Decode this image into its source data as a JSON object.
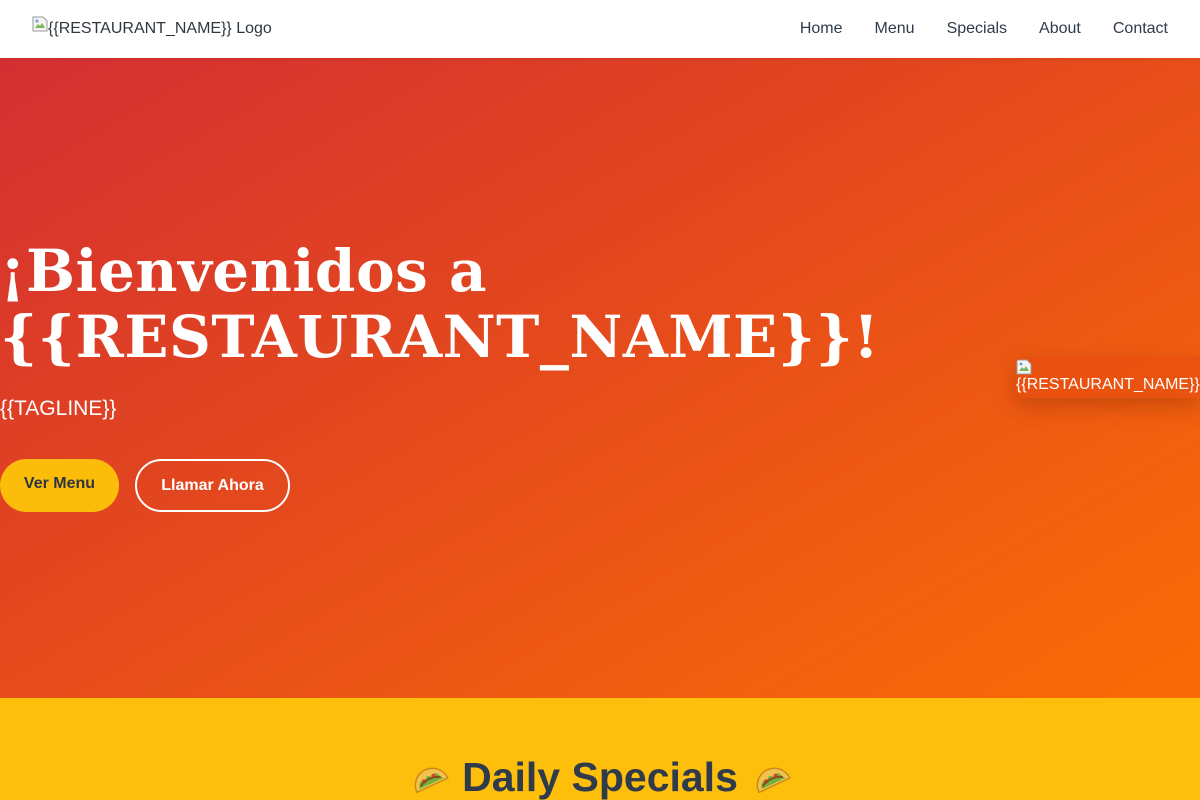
{
  "header": {
    "logo_alt": "{{RESTAURANT_NAME}} Logo",
    "nav": [
      "Home",
      "Menu",
      "Specials",
      "About",
      "Contact"
    ]
  },
  "hero": {
    "title_line1": "¡Bienvenidos a",
    "title_line2": "{{RESTAURANT_NAME}}!",
    "tagline": "{{TAGLINE}}",
    "menu_button": "Ver Menu",
    "call_button": "Llamar Ahora",
    "image_alt": "{{RESTAURANT_NAME}}"
  },
  "specials": {
    "title": "Daily Specials",
    "icon": "taco-icon"
  },
  "colors": {
    "gradient_start": "#d42f33",
    "gradient_end": "#fb6b05",
    "accent_yellow": "#fbbc0a",
    "text_dark": "#2f3640"
  }
}
